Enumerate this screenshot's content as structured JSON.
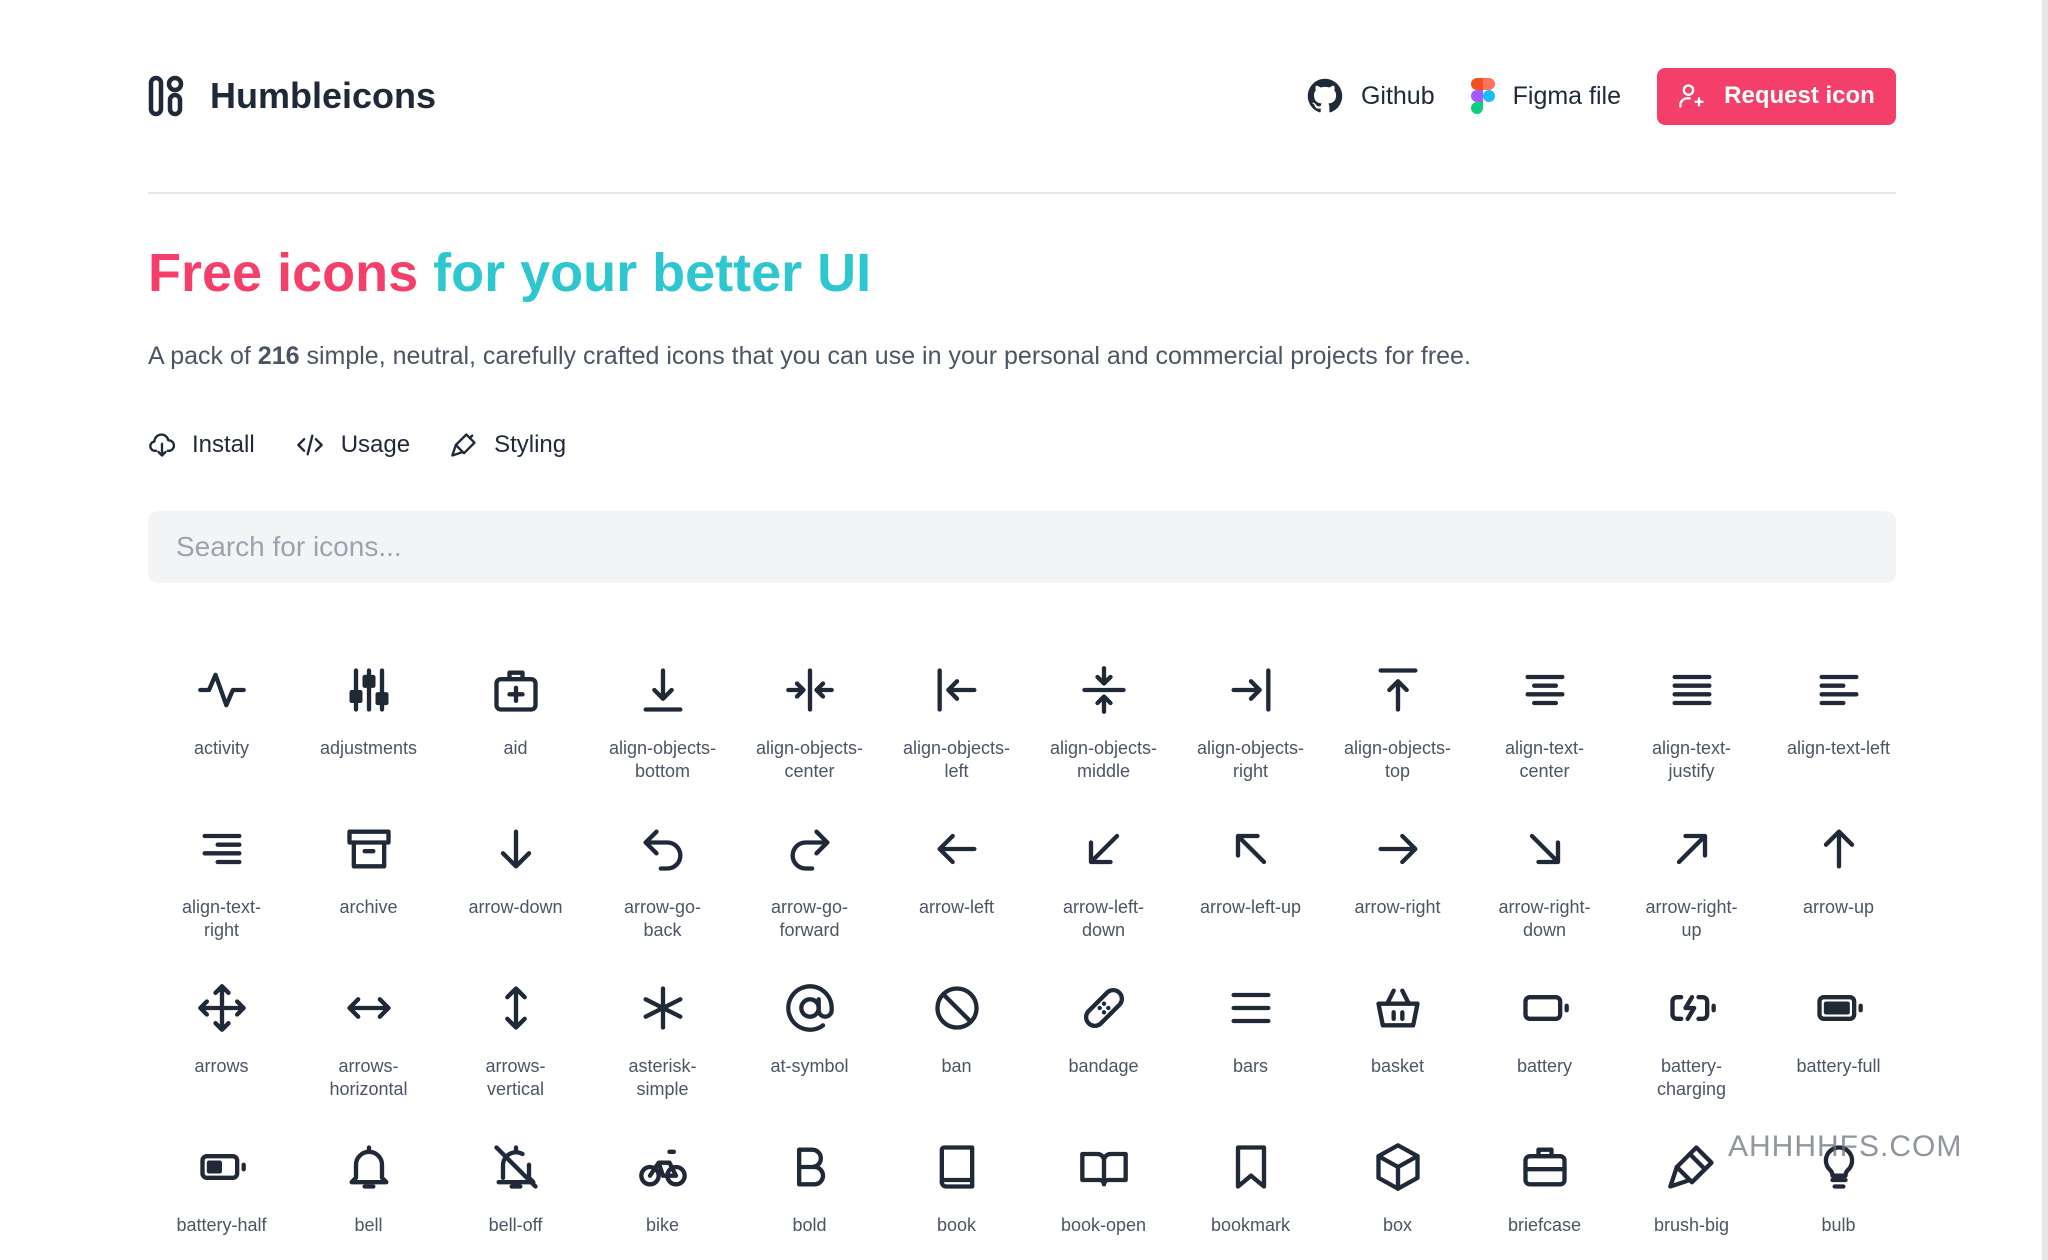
{
  "brand": {
    "name": "Humbleicons"
  },
  "nav": {
    "github": "Github",
    "figma": "Figma file",
    "request": "Request icon"
  },
  "hero": {
    "title_part1": "Free icons",
    "title_part2": "for your better UI",
    "desc_pre": "A pack of ",
    "desc_count": "216",
    "desc_post": " simple, neutral, carefully crafted icons that you can use in your personal and commercial projects for free."
  },
  "tabs": {
    "install": "Install",
    "usage": "Usage",
    "styling": "Styling"
  },
  "search": {
    "placeholder": "Search for icons..."
  },
  "icons": [
    [
      "activity",
      "adjustments",
      "aid",
      "align-objects-bottom",
      "align-objects-center",
      "align-objects-left",
      "align-objects-middle",
      "align-objects-right",
      "align-objects-top",
      "align-text-center",
      "align-text-justify",
      "align-text-left"
    ],
    [
      "align-text-right",
      "archive",
      "arrow-down",
      "arrow-go-back",
      "arrow-go-forward",
      "arrow-left",
      "arrow-left-down",
      "arrow-left-up",
      "arrow-right",
      "arrow-right-down",
      "arrow-right-up",
      "arrow-up"
    ],
    [
      "arrows",
      "arrows-horizontal",
      "arrows-vertical",
      "asterisk-simple",
      "at-symbol",
      "ban",
      "bandage",
      "bars",
      "basket",
      "battery",
      "battery-charging",
      "battery-full"
    ],
    [
      "battery-half",
      "bell",
      "bell-off",
      "bike",
      "bold",
      "book",
      "book-open",
      "bookmark",
      "box",
      "briefcase",
      "brush-big",
      "bulb"
    ]
  ],
  "watermark": "AHHHHFS.COM",
  "colors": {
    "accent": "#f43f6b",
    "teal": "#2ec7cf",
    "text": "#1f2937",
    "muted": "#4b5563"
  }
}
